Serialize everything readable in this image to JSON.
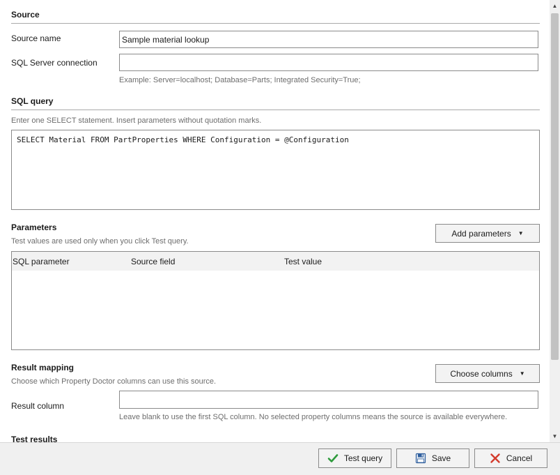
{
  "source_section": {
    "title": "Source",
    "name_label": "Source name",
    "name_value": "Sample material lookup",
    "connection_label": "SQL Server connection",
    "connection_value": "",
    "connection_hint": "Example: Server=localhost; Database=Parts; Integrated Security=True;"
  },
  "sql_section": {
    "title": "SQL query",
    "hint": "Enter one SELECT statement. Insert parameters without quotation marks.",
    "query": "SELECT Material FROM PartProperties WHERE Configuration = @Configuration"
  },
  "parameters_section": {
    "title": "Parameters",
    "hint": "Test values are used only when you click Test query.",
    "add_button": "Add parameters",
    "columns": [
      "SQL parameter",
      "Source field",
      "Test value"
    ]
  },
  "mapping_section": {
    "title": "Result mapping",
    "hint": "Choose which Property Doctor columns can use this source.",
    "choose_button": "Choose columns",
    "result_column_label": "Result column",
    "result_column_value": "",
    "result_column_hint": "Leave blank to use the first SQL column. No selected property columns means the source is available everywhere."
  },
  "results_section": {
    "title": "Test results"
  },
  "footer": {
    "test_button": "Test query",
    "save_button": "Save",
    "cancel_button": "Cancel"
  },
  "icons": {
    "dropdown": "caret-down-icon",
    "test": "checkmark-icon",
    "save": "floppy-disk-icon",
    "cancel": "x-mark-icon"
  },
  "colors": {
    "check_green": "#2e9b3c",
    "cancel_red": "#d33b2c",
    "save_blue": "#2f5f9e"
  }
}
